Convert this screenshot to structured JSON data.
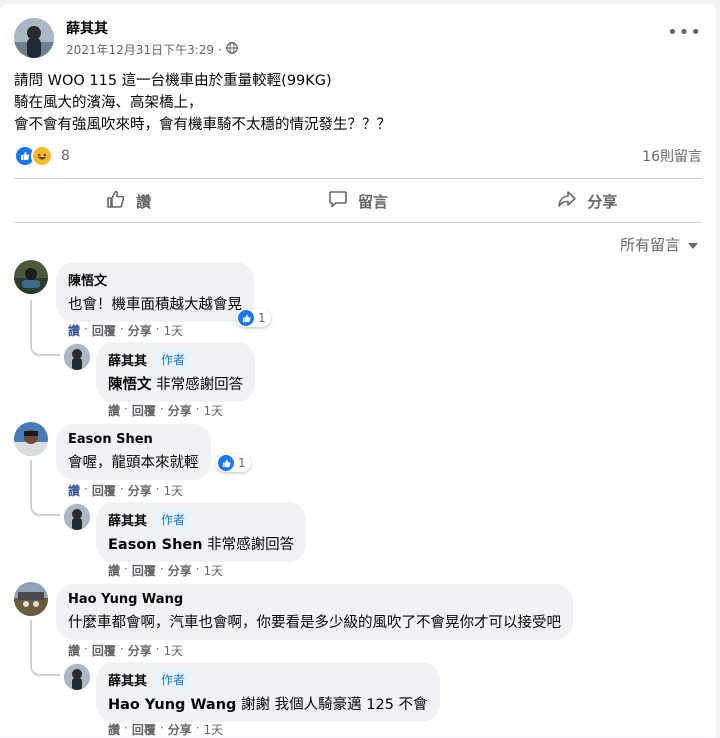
{
  "post": {
    "author": "薛其其",
    "timestamp": "2021年12月31日下午3:29",
    "audience_icon": "globe-icon",
    "more": "•••",
    "body_lines": [
      "請問 WOO 115 這一台機車由於重量較輕(99KG)",
      "騎在風大的濱海、高架橋上，",
      "會不會有強風吹來時，會有機車騎不太穩的情況發生？？？"
    ],
    "reaction_count": "8",
    "comments_count": "16則留言"
  },
  "actions": {
    "like": "讚",
    "comment": "留言",
    "share": "分享"
  },
  "sort_label": "所有留言",
  "comment_action_labels": {
    "like": "讚",
    "reply": "回覆",
    "share": "分享",
    "sep": "·"
  },
  "comments": [
    {
      "name": "陳悟文",
      "text": "也會！機車面積越大越會晃",
      "age": "1天",
      "reactions": "1"
    },
    {
      "name": "薛其其",
      "badge": "作者",
      "mention": "陳悟文",
      "text": " 非常感謝回答",
      "age": "1天"
    },
    {
      "name": "Eason Shen",
      "text": "會喔，龍頭本來就輕",
      "age": "1天",
      "reactions": "1"
    },
    {
      "name": "薛其其",
      "badge": "作者",
      "mention": "Eason Shen",
      "text": " 非常感謝回答",
      "age": "1天"
    },
    {
      "name": "Hao Yung Wang",
      "text": "什麼車都會啊，汽車也會啊，你要看是多少級的風吹了不會晃你才可以接受吧",
      "age": "1天"
    },
    {
      "name": "薛其其",
      "badge": "作者",
      "mention": "Hao Yung Wang",
      "text": " 謝謝 我個人騎豪邁 125 不會",
      "age": "1天"
    }
  ],
  "colors": {
    "accent": "#1877f2",
    "bubble": "#f0f2f5",
    "secondary_text": "#65676b"
  }
}
